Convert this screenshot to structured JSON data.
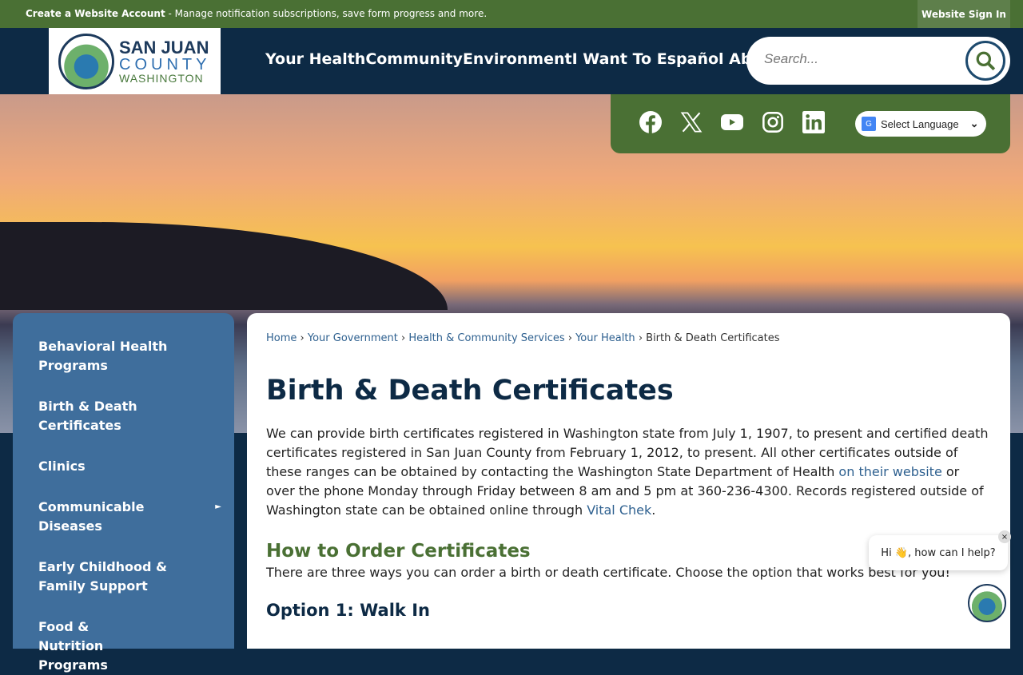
{
  "topbar": {
    "account_link": "Create a Website Account",
    "account_desc": " - Manage notification subscriptions, save form progress and more.",
    "signin": "Website Sign In"
  },
  "logo": {
    "line1": "SAN JUAN",
    "line2": "COUNTY",
    "line3": "WASHINGTON"
  },
  "nav": [
    "Your Health",
    "Community",
    "Environment",
    "I Want To ",
    "Español ",
    "About"
  ],
  "search": {
    "placeholder": "Search..."
  },
  "social": [
    "facebook",
    "x",
    "youtube",
    "instagram",
    "linkedin"
  ],
  "language": {
    "label": "Select Language"
  },
  "sidebar": [
    {
      "label": "Behavioral Health Programs"
    },
    {
      "label": "Birth & Death Certificates"
    },
    {
      "label": "Clinics"
    },
    {
      "label": "Communicable Diseases",
      "arrow": "►"
    },
    {
      "label": "Early Childhood & Family Support"
    },
    {
      "label": "Food & Nutrition Programs"
    }
  ],
  "breadcrumb": [
    "Home",
    "Your Government",
    "Health & Community Services",
    "Your Health",
    "Birth & Death Certificates"
  ],
  "breadcrumb_sep": "›",
  "page": {
    "title": "Birth & Death Certificates",
    "intro_1": "We can provide birth certificates registered in Washington state from July 1, 1907, to present and certified death certificates registered in San Juan County from February 1, 2012, to present. All other certificates outside of these ranges can be obtained by contacting the Washington State Department of Health ",
    "intro_link1": "on their website",
    "intro_2": " or over the phone Monday through Friday between 8 am and 5 pm at 360-236-4300. Records registered outside of Washington state can be obtained online through ",
    "intro_link2": "Vital Chek",
    "intro_3": ".",
    "h2": "How to Order Certificates",
    "p2": "There are three ways you can order a birth or death certificate. Choose the option that works best for you!",
    "h3": "Option 1: Walk In"
  },
  "chat": {
    "message": "Hi 👋, how can I help?",
    "close": "×"
  }
}
